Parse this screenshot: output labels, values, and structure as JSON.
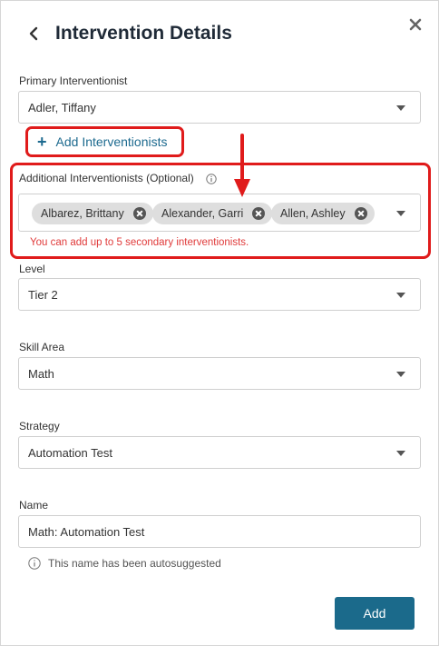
{
  "header": {
    "title": "Intervention Details"
  },
  "primary": {
    "label": "Primary Interventionist",
    "value": "Adler, Tiffany"
  },
  "add_interventionists": {
    "label": "Add Interventionists"
  },
  "additional": {
    "label": "Additional Interventionists (Optional)",
    "chips": [
      "Albarez, Brittany",
      "Alexander, Garri",
      "Allen, Ashley"
    ],
    "error": "You can add up to 5 secondary interventionists."
  },
  "level": {
    "label": "Level",
    "value": "Tier 2"
  },
  "skill_area": {
    "label": "Skill Area",
    "value": "Math"
  },
  "strategy": {
    "label": "Strategy",
    "value": "Automation Test"
  },
  "name": {
    "label": "Name",
    "value": "Math: Automation Test",
    "note": "This name has been autosuggested"
  },
  "footer": {
    "add_label": "Add"
  },
  "colors": {
    "accent": "#1b6a8b",
    "annotation": "#e01b1b",
    "error": "#e03a3a"
  }
}
